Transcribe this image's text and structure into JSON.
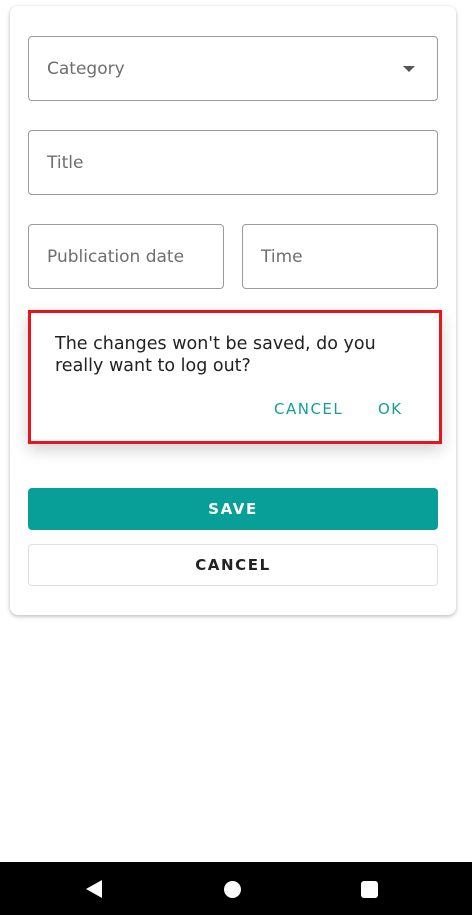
{
  "form": {
    "category_placeholder": "Category",
    "title_placeholder": "Title",
    "publication_date_placeholder": "Publication date",
    "time_placeholder": "Time"
  },
  "dialog": {
    "message": "The changes won't be saved, do you really want to log out?",
    "cancel_label": "CANCEL",
    "ok_label": "OK"
  },
  "buttons": {
    "save_label": "SAVE",
    "cancel_label": "CANCEL"
  },
  "colors": {
    "accent": "#099f99",
    "highlight_border": "#e8141a"
  },
  "navbar": {
    "icons": [
      "back-icon",
      "home-icon",
      "recent-apps-icon"
    ]
  }
}
